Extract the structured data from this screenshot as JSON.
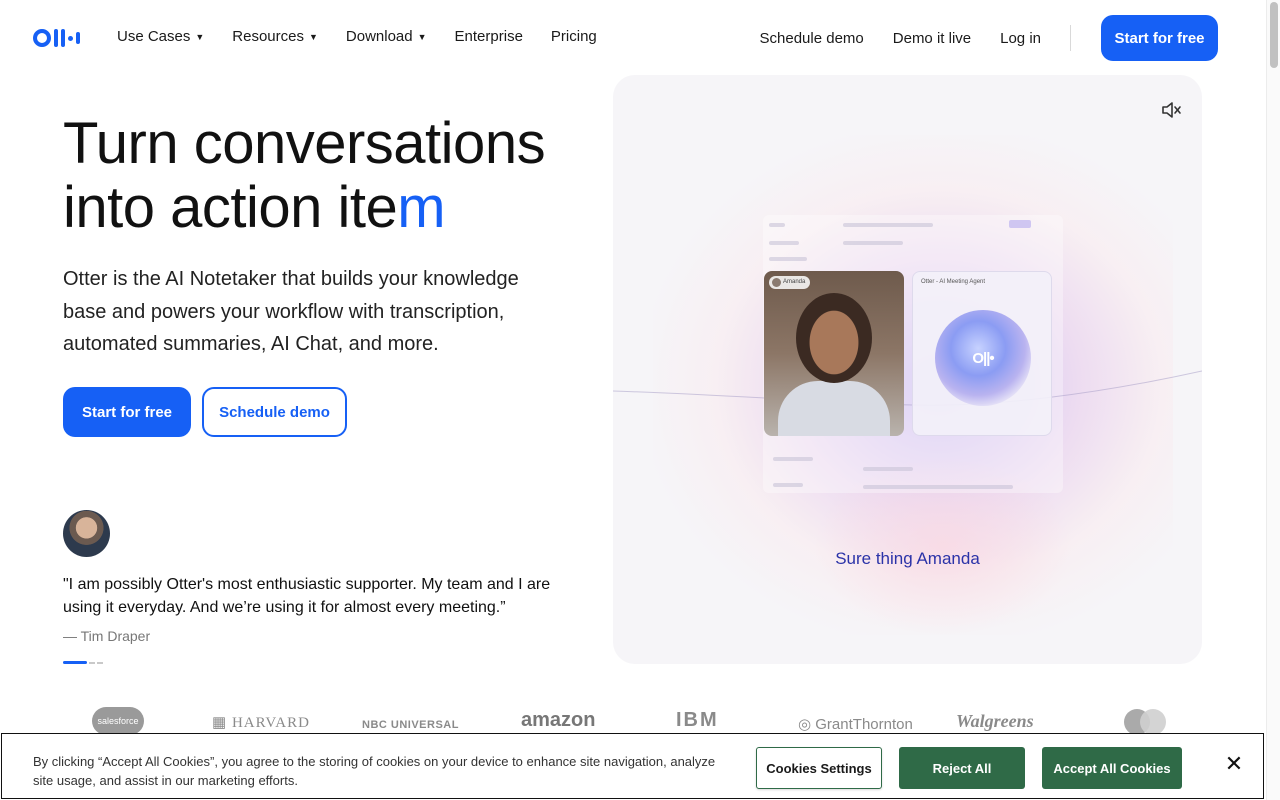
{
  "nav": {
    "logo_icon": "otter-logo-icon",
    "items": [
      {
        "label": "Use Cases",
        "has_menu": true
      },
      {
        "label": "Resources",
        "has_menu": true
      },
      {
        "label": "Download",
        "has_menu": true
      },
      {
        "label": "Enterprise",
        "has_menu": false
      },
      {
        "label": "Pricing",
        "has_menu": false
      }
    ],
    "schedule_demo": "Schedule demo",
    "demo_live": "Demo it live",
    "log_in": "Log in",
    "cta": "Start for free"
  },
  "hero": {
    "title_line1": "Turn conversations",
    "title_line2_prefix": "into action ite",
    "title_line2_accent": "m",
    "subtitle": "Otter is the AI Notetaker that builds your knowledge base and powers your workflow with transcription, automated summaries, AI Chat, and more.",
    "primary_button": "Start for free",
    "secondary_button": "Schedule demo",
    "quote": "\"I am possibly Otter's most enthusiastic supporter. My team and I are using it everyday. And we’re using it for almost every meeting.”",
    "quote_author": "— Tim Draper",
    "carousel_active_index": 1,
    "carousel_count": 3
  },
  "video": {
    "mute_icon": "speaker-muted-icon",
    "participant_name": "Amanda",
    "agent_label": "Otter - AI Meeting Agent",
    "caption": "Sure thing Amanda"
  },
  "logos": {
    "salesforce": "salesforce",
    "harvard": "HARVARD",
    "nbc": "NBC UNIVERSAL",
    "amazon": "amazon",
    "ibm": "IBM",
    "grant_thornton": "GrantThornton",
    "walgreens": "Walgreens"
  },
  "cookie": {
    "text": "By clicking “Accept All Cookies”, you agree to the storing of cookies on your device to enhance site navigation, analyze site usage, and assist in our marketing efforts.",
    "settings": "Cookies Settings",
    "reject": "Reject All",
    "accept": "Accept All Cookies",
    "close_icon": "close-icon"
  },
  "colors": {
    "brand_blue": "#1660f5",
    "cookie_green": "#2f6a47",
    "caption_blue": "#2b33a8"
  }
}
